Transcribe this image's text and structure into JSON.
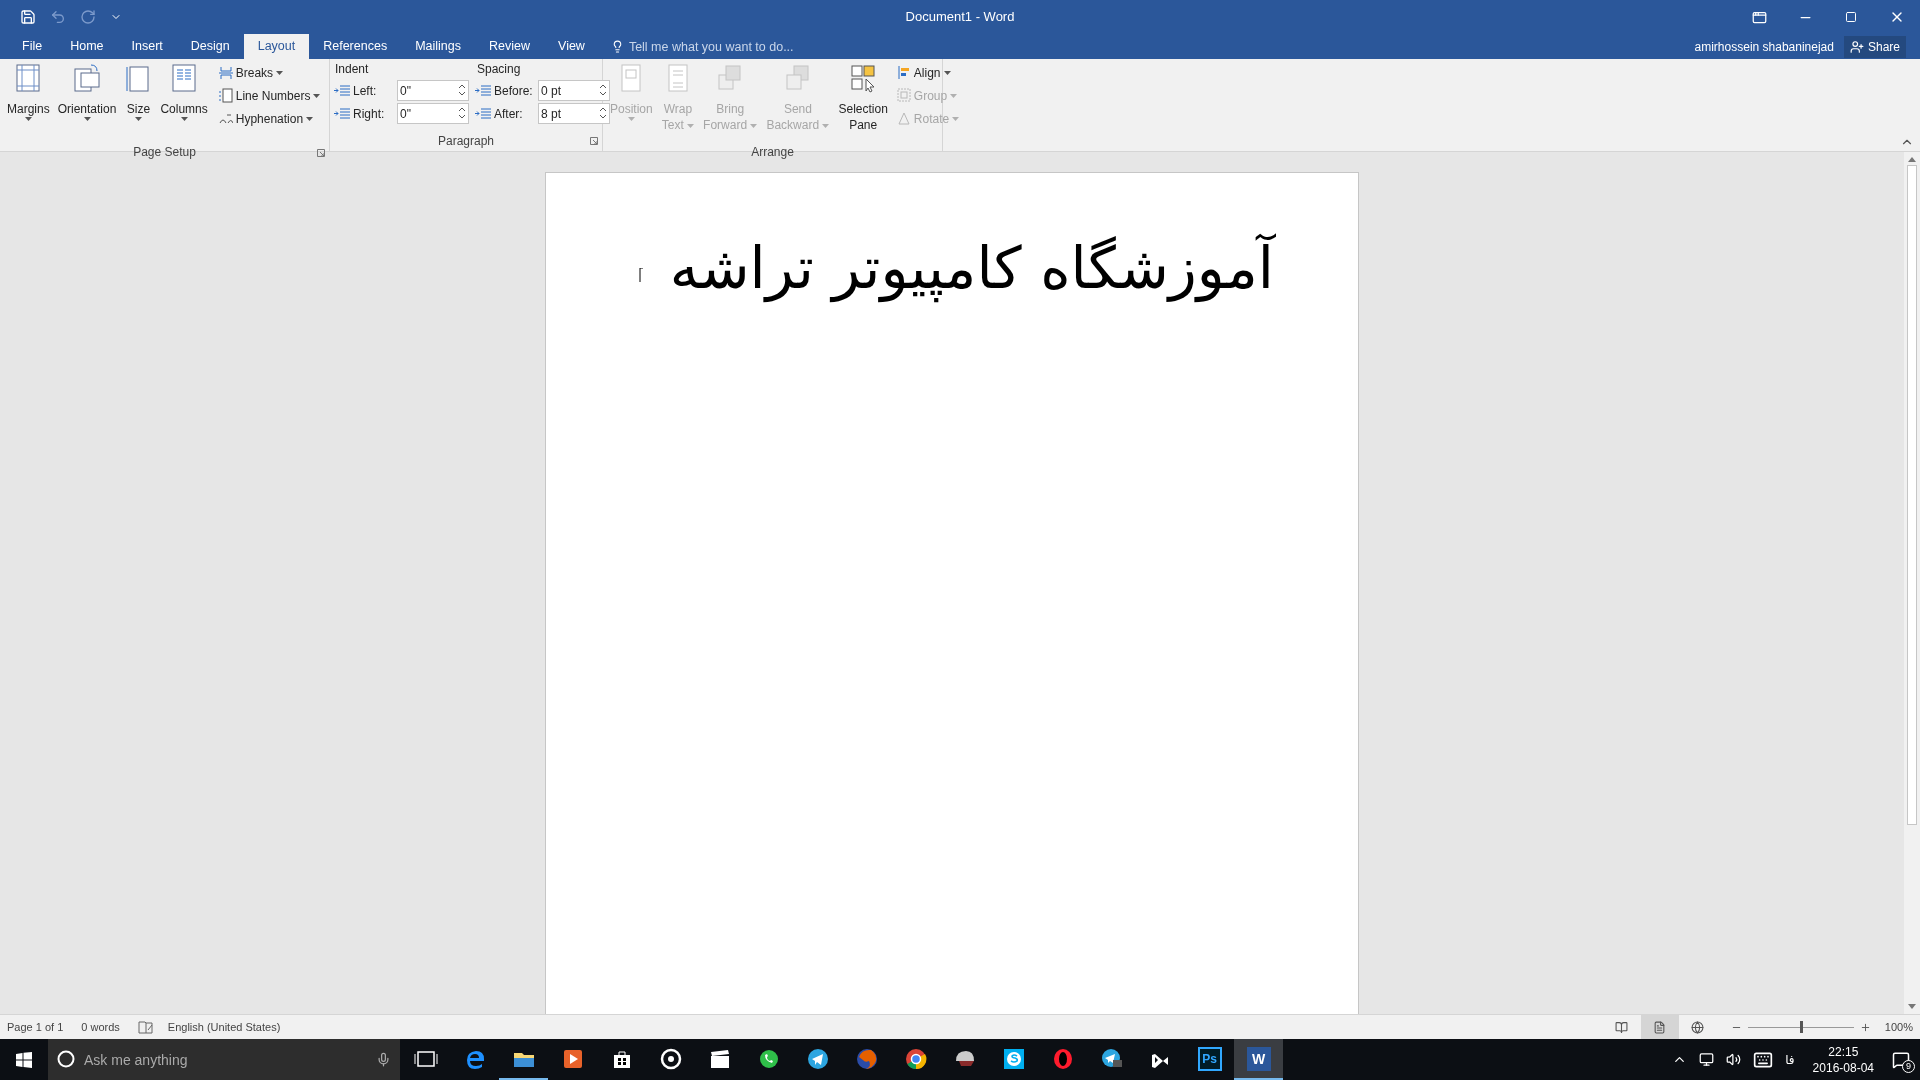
{
  "window": {
    "title": "Document1 - Word"
  },
  "quick_access": [
    {
      "kind": "save",
      "disabled": false
    },
    {
      "kind": "undo",
      "disabled": true
    },
    {
      "kind": "redo",
      "disabled": true
    },
    {
      "kind": "customize",
      "disabled": false
    }
  ],
  "tabs": [
    {
      "label": "File",
      "selected": false
    },
    {
      "label": "Home",
      "selected": false
    },
    {
      "label": "Insert",
      "selected": false
    },
    {
      "label": "Design",
      "selected": false
    },
    {
      "label": "Layout",
      "selected": true
    },
    {
      "label": "References",
      "selected": false
    },
    {
      "label": "Mailings",
      "selected": false
    },
    {
      "label": "Review",
      "selected": false
    },
    {
      "label": "View",
      "selected": false
    }
  ],
  "tell_me": {
    "placeholder": "Tell me what you want to do..."
  },
  "account": {
    "user": "amirhossein shabaninejad",
    "share": "Share"
  },
  "page_setup": {
    "title": "Page Setup",
    "large_buttons": [
      {
        "kind": "margins",
        "lines": [
          "Margins"
        ],
        "dropdown": true
      },
      {
        "kind": "orientation",
        "lines": [
          "Orientation"
        ],
        "dropdown": true
      },
      {
        "kind": "size",
        "lines": [
          "Size"
        ],
        "dropdown": true
      },
      {
        "kind": "columns",
        "lines": [
          "Columns"
        ],
        "dropdown": true
      }
    ],
    "small_buttons": [
      {
        "kind": "breaks",
        "label": "Breaks"
      },
      {
        "kind": "line-numbers",
        "label": "Line Numbers"
      },
      {
        "kind": "hyphenation",
        "label": "Hyphenation"
      }
    ]
  },
  "paragraph": {
    "title": "Paragraph",
    "indent": {
      "heading": "Indent",
      "fields": [
        {
          "label": "Left:",
          "value": "0\""
        },
        {
          "label": "Right:",
          "value": "0\""
        }
      ]
    },
    "spacing": {
      "heading": "Spacing",
      "fields": [
        {
          "label": "Before:",
          "value": "0 pt"
        },
        {
          "label": "After:",
          "value": "8 pt"
        }
      ]
    }
  },
  "arrange": {
    "title": "Arrange",
    "large_buttons": [
      {
        "kind": "position",
        "lines": [
          "Position"
        ],
        "dropdown": true,
        "disabled": true
      },
      {
        "kind": "wrap",
        "lines": [
          "Wrap",
          "Text"
        ],
        "dropdown": true,
        "disabled": true
      },
      {
        "kind": "forward",
        "lines": [
          "Bring",
          "Forward"
        ],
        "dropdown": true,
        "disabled": true
      },
      {
        "kind": "backward",
        "lines": [
          "Send",
          "Backward"
        ],
        "dropdown": true,
        "disabled": true
      },
      {
        "kind": "selection",
        "lines": [
          "Selection",
          "Pane"
        ],
        "dropdown": false,
        "disabled": false
      }
    ],
    "small_buttons": [
      {
        "kind": "align",
        "label": "Align",
        "disabled": false
      },
      {
        "kind": "group",
        "label": "Group",
        "disabled": true
      },
      {
        "kind": "rotate",
        "label": "Rotate",
        "disabled": true
      }
    ]
  },
  "document": {
    "text": "آموزشگاه کامپیوتر تراشه"
  },
  "status_bar": {
    "page": "Page 1 of 1",
    "words": "0 words",
    "language": "English (United States)",
    "views": [
      {
        "kind": "read",
        "selected": false
      },
      {
        "kind": "print",
        "selected": true
      },
      {
        "kind": "web",
        "selected": false
      }
    ],
    "zoom": {
      "level": 0.5,
      "reading": "100%"
    }
  },
  "taskbar": {
    "search": {
      "placeholder": "Ask me anything"
    },
    "apps": [
      {
        "kind": "task-view",
        "running": false,
        "selected": false
      },
      {
        "kind": "edge",
        "running": false,
        "selected": false
      },
      {
        "kind": "folder",
        "running": true,
        "selected": false
      },
      {
        "kind": "player",
        "running": false,
        "selected": false
      },
      {
        "kind": "store",
        "running": false,
        "selected": false
      },
      {
        "kind": "disc",
        "running": false,
        "selected": false
      },
      {
        "kind": "clapper",
        "running": false,
        "selected": false
      },
      {
        "kind": "phone-chat",
        "running": false,
        "selected": false
      },
      {
        "kind": "plane",
        "running": false,
        "selected": false
      },
      {
        "kind": "fox",
        "running": false,
        "selected": false
      },
      {
        "kind": "chrome",
        "running": false,
        "selected": false
      },
      {
        "kind": "helmet",
        "running": false,
        "selected": false
      },
      {
        "kind": "skype",
        "running": false,
        "selected": false
      },
      {
        "kind": "opera",
        "running": false,
        "selected": false
      },
      {
        "kind": "plane-chat",
        "running": false,
        "selected": false
      },
      {
        "kind": "vs",
        "running": false,
        "selected": false
      },
      {
        "kind": "ps",
        "label": "Ps",
        "running": false,
        "selected": false
      },
      {
        "kind": "word",
        "label": "W",
        "running": true,
        "selected": true
      }
    ],
    "tray": {
      "input_language": "فا",
      "time": "22:15",
      "date": "2016-08-04",
      "notifications": "9"
    }
  }
}
